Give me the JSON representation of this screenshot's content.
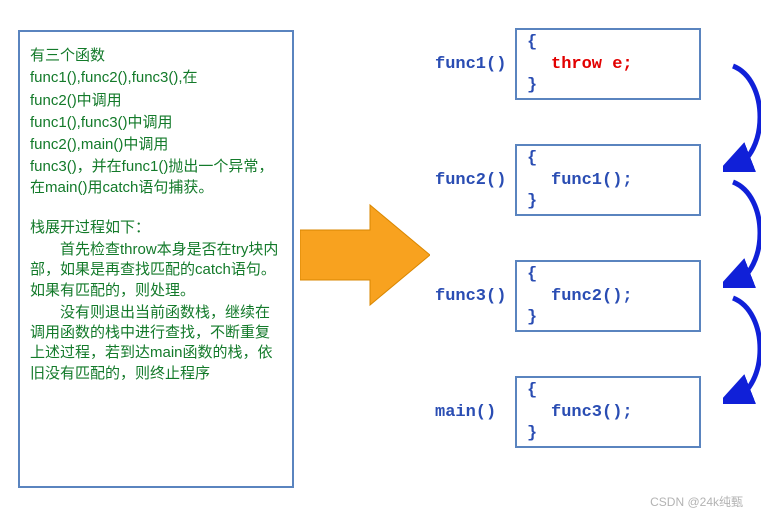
{
  "text_panel": {
    "p1_title": "有三个函数",
    "p1_l1": "func1(),func2(),func3(),在",
    "p1_l2": "func2()中调用",
    "p1_l3": "func1(),func3()中调用",
    "p1_l4": "func2(),main()中调用",
    "p1_l5": "func3()，并在func1()抛出一个异常，在main()用catch语句捕获。",
    "p2_title": "栈展开过程如下：",
    "p2_l1": "首先检查throw本身是否在try块内部，如果是再查找匹配的catch语句。如果有匹配的，则处理。",
    "p2_l2": "没有则退出当前函数栈，继续在调用函数的栈中进行查找，不断重复上述过程，若到达main函数的栈，依旧没有匹配的，则终止程序"
  },
  "stack": [
    {
      "label": "func1()",
      "brace_open": "{",
      "body": "throw e;",
      "brace_close": "}",
      "is_throw": true
    },
    {
      "label": "func2()",
      "brace_open": "{",
      "body": "func1();",
      "brace_close": "}",
      "is_throw": false
    },
    {
      "label": "func3()",
      "brace_open": "{",
      "body": "func2();",
      "brace_close": "}",
      "is_throw": false
    },
    {
      "label": "main()",
      "brace_open": "{",
      "body": "func3();",
      "brace_close": "}",
      "is_throw": false
    }
  ],
  "watermark": "CSDN @24k纯甄"
}
